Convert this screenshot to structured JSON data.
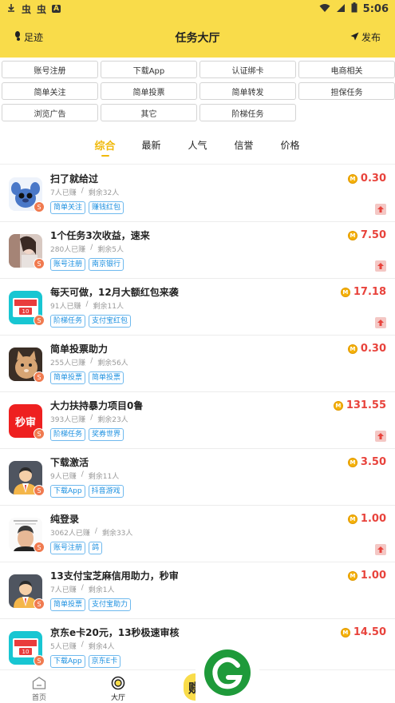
{
  "status_bar": {
    "time": "5:06",
    "glyphs": [
      "虫",
      "虫",
      "A"
    ]
  },
  "header": {
    "title": "任务大厅",
    "left_label": "足迹",
    "right_label": "发布"
  },
  "categories": [
    "账号注册",
    "下载App",
    "认证绑卡",
    "电商相关",
    "简单关注",
    "简单投票",
    "简单转发",
    "担保任务",
    "浏览广告",
    "其它",
    "阶梯任务"
  ],
  "sort_tabs": [
    "综合",
    "最新",
    "人气",
    "信誉",
    "价格"
  ],
  "tasks": [
    {
      "title": "扫了就给过",
      "earned": "7人已赚",
      "remaining": "剩余32人",
      "tags": [
        "简单关注",
        "赚钱红包"
      ],
      "price": "0.30",
      "thumb": "stitch",
      "upgrade": true
    },
    {
      "title": "1个任务3次收益，速来",
      "earned": "280人已赚",
      "remaining": "剩余5人",
      "tags": [
        "账号注册",
        "南京银行"
      ],
      "price": "7.50",
      "thumb": "photo",
      "upgrade": true
    },
    {
      "title": "每天可做，12月大额红包来袭",
      "earned": "91人已赚",
      "remaining": "剩余11人",
      "tags": [
        "阶梯任务",
        "支付宝红包"
      ],
      "price": "17.18",
      "thumb": "jd",
      "upgrade": true
    },
    {
      "title": "简单投票助力",
      "earned": "255人已赚",
      "remaining": "剩余56人",
      "tags": [
        "简单投票",
        "简单投票"
      ],
      "price": "0.30",
      "thumb": "cat",
      "upgrade": false
    },
    {
      "title": "大力扶持暴力项目0鲁",
      "earned": "393人已赚",
      "remaining": "剩余23人",
      "tags": [
        "阶梯任务",
        "奖券世界"
      ],
      "price": "131.55",
      "thumb": "miaoshen",
      "thumb_text": "秒审",
      "upgrade": true
    },
    {
      "title": "下载激活",
      "earned": "9人已赚",
      "remaining": "剩余11人",
      "tags": [
        "下载App",
        "抖音游戏"
      ],
      "price": "3.50",
      "thumb": "avatar",
      "upgrade": false
    },
    {
      "title": "纯登录",
      "earned": "3062人已赚",
      "remaining": "剩余33人",
      "tags": [
        "账号注册",
        "鸽"
      ],
      "price": "1.00",
      "thumb": "face",
      "upgrade": true
    },
    {
      "title": "13支付宝芝麻信用助力，秒审",
      "earned": "7人已赚",
      "remaining": "剩余1人",
      "tags": [
        "简单投票",
        "支付宝助力"
      ],
      "price": "1.00",
      "thumb": "avatar",
      "upgrade": false
    },
    {
      "title": "京东e卡20元，13秒极速审核",
      "earned": "5人已赚",
      "remaining": "剩余4人",
      "tags": [
        "下载App",
        "京东E卡"
      ],
      "price": "14.50",
      "thumb": "jd",
      "upgrade": false
    }
  ],
  "bottom_nav": {
    "home": "首页",
    "hall": "大厅",
    "earn_glyph": "赚"
  },
  "colors": {
    "brand_yellow": "#f9dc4a",
    "price_red": "#e8433c",
    "tag_blue": "#1a8fe0",
    "active_tab": "#f0b90b"
  }
}
